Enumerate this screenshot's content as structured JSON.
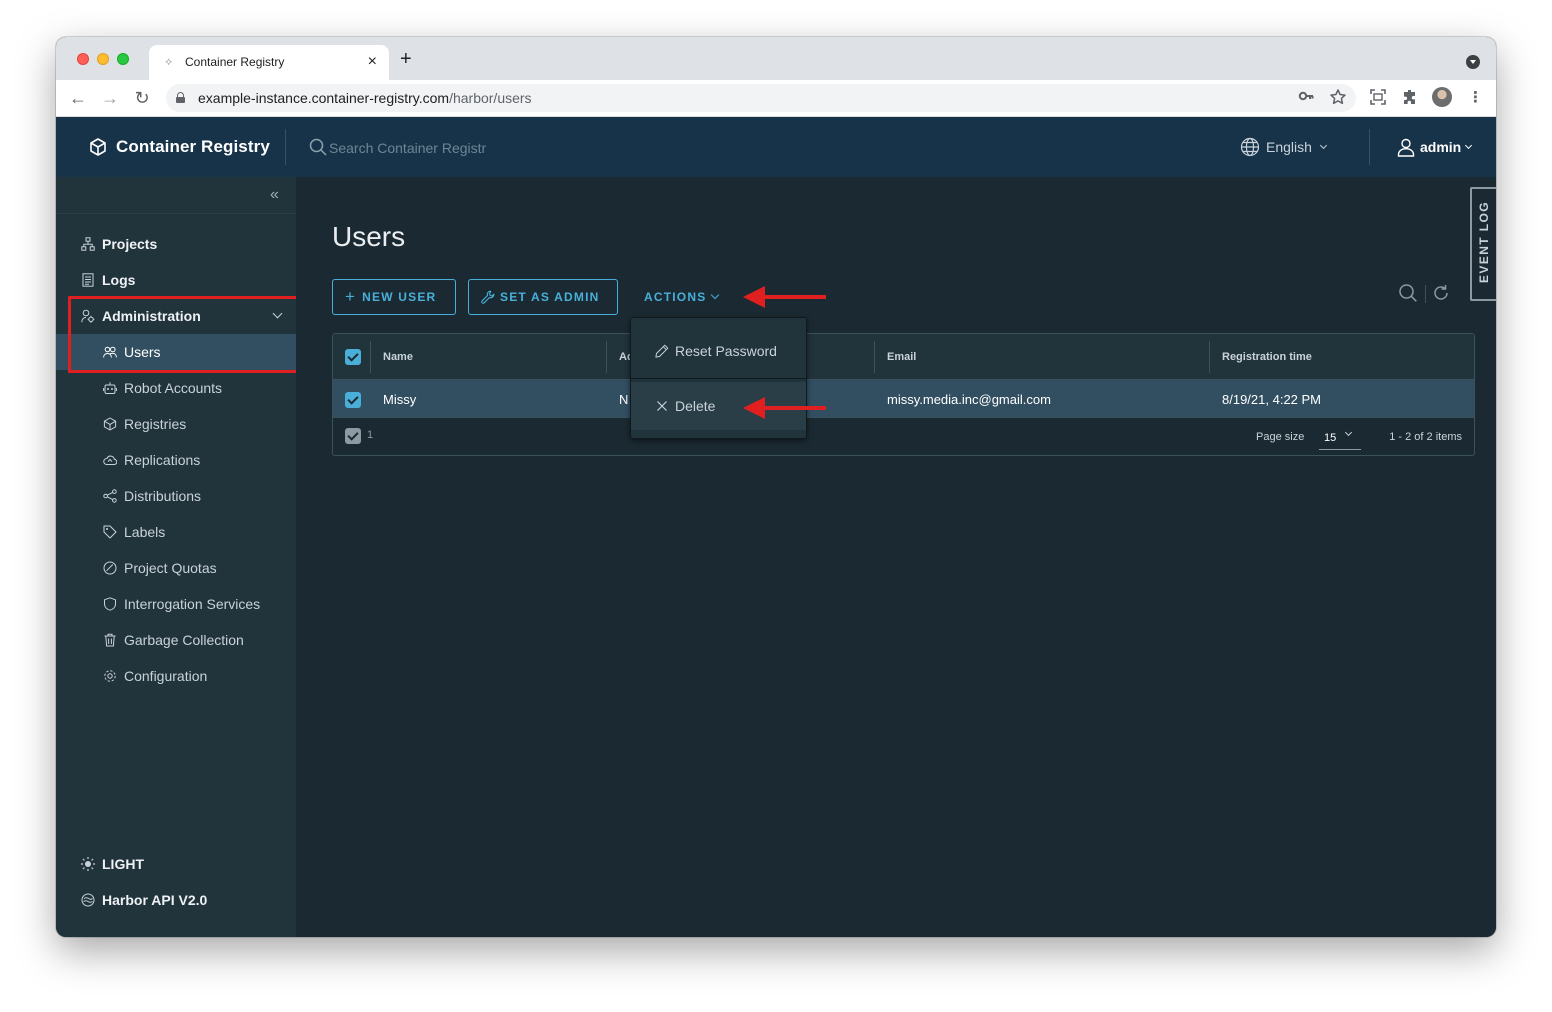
{
  "browser": {
    "tab_title": "Container Registry",
    "url_host": "example-instance.container-registry.com",
    "url_path": "/harbor/users"
  },
  "app": {
    "title": "Container Registry",
    "search_placeholder": "Search Container Registr",
    "language": "English",
    "user": "admin"
  },
  "sidebar": {
    "items": [
      {
        "label": "Projects",
        "icon": "projects-icon"
      },
      {
        "label": "Logs",
        "icon": "logs-icon"
      },
      {
        "label": "Administration",
        "icon": "administration-icon"
      },
      {
        "label": "Users",
        "icon": "users-icon"
      },
      {
        "label": "Robot Accounts",
        "icon": "robot-icon"
      },
      {
        "label": "Registries",
        "icon": "registries-icon"
      },
      {
        "label": "Replications",
        "icon": "replications-icon"
      },
      {
        "label": "Distributions",
        "icon": "distributions-icon"
      },
      {
        "label": "Labels",
        "icon": "tag-icon"
      },
      {
        "label": "Project Quotas",
        "icon": "quota-icon"
      },
      {
        "label": "Interrogation Services",
        "icon": "shield-icon"
      },
      {
        "label": "Garbage Collection",
        "icon": "trash-icon"
      },
      {
        "label": "Configuration",
        "icon": "gear-icon"
      }
    ],
    "theme_toggle": "LIGHT",
    "api_link": "Harbor API V2.0"
  },
  "main": {
    "title": "Users",
    "buttons": {
      "new_user": "NEW USER",
      "set_admin": "SET AS ADMIN",
      "actions": "ACTIONS"
    },
    "actions_menu": {
      "reset_password": "Reset Password",
      "delete": "Delete"
    },
    "table": {
      "columns": [
        "Name",
        "Ad",
        "Email",
        "Registration time"
      ],
      "rows": [
        {
          "name": "Missy",
          "admin": "N",
          "email": "missy.media.inc@gmail.com",
          "registered": "8/19/21, 4:22 PM"
        }
      ],
      "selected_count": "1",
      "page_size_label": "Page size",
      "page_size": "15",
      "range": "1 - 2 of 2 items"
    }
  },
  "event_log": "EVENT LOG",
  "colors": {
    "accent": "#49afd9",
    "header_bg": "#17334a",
    "sidebar_bg": "#21333b",
    "content_bg": "#1b2a32",
    "annotation_red": "#e02020"
  }
}
